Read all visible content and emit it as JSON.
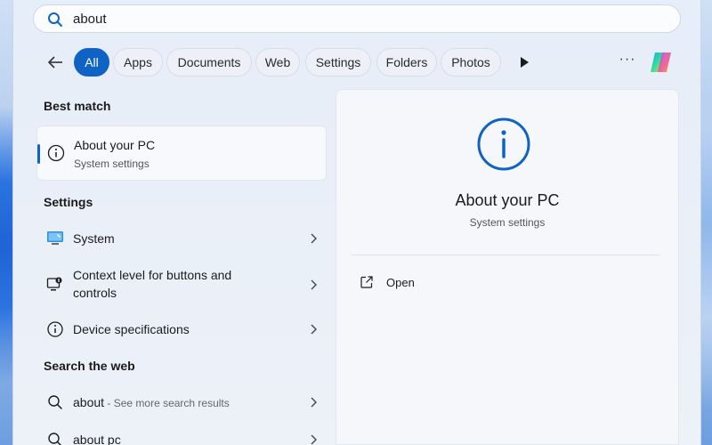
{
  "search": {
    "value": "about",
    "placeholder": ""
  },
  "filters": {
    "back_icon": "back-arrow-icon",
    "chips": [
      {
        "label": "All",
        "active": true
      },
      {
        "label": "Apps",
        "active": false
      },
      {
        "label": "Documents",
        "active": false
      },
      {
        "label": "Web",
        "active": false
      },
      {
        "label": "Settings",
        "active": false
      },
      {
        "label": "Folders",
        "active": false
      },
      {
        "label": "Photos",
        "active": false
      }
    ],
    "more_label": "···"
  },
  "results": {
    "best_match_title": "Best match",
    "best_match": {
      "title": "About your PC",
      "subtitle": "System settings",
      "icon": "info-icon"
    },
    "settings_title": "Settings",
    "settings_items": [
      {
        "label": "System",
        "icon": "monitor-icon"
      },
      {
        "label": "Context level for buttons and controls",
        "icon": "context-icon"
      },
      {
        "label": "Device specifications",
        "icon": "info-icon"
      }
    ],
    "web_title": "Search the web",
    "web_items": [
      {
        "term": "about",
        "suffix": " - See more search results",
        "icon": "search-icon"
      },
      {
        "term": "about pc",
        "suffix": "",
        "icon": "search-icon"
      }
    ]
  },
  "preview": {
    "title": "About your PC",
    "subtitle": "System settings",
    "open_label": "Open",
    "icon": "info-icon"
  },
  "colors": {
    "accent": "#0f63c4",
    "panel": "#e9eff8"
  }
}
